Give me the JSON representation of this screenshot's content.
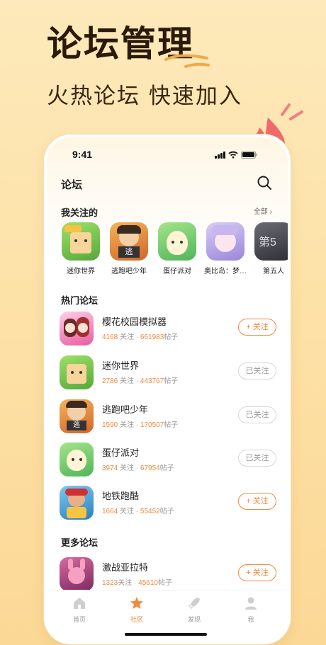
{
  "promo": {
    "title": "论坛管理",
    "subtitle": "火热论坛 快速加入"
  },
  "status_bar": {
    "time": "9:41"
  },
  "header": {
    "title": "论坛"
  },
  "followed": {
    "title": "我关注的",
    "see_all": "全部",
    "items": [
      {
        "label": "迷你世界",
        "color": "#7fc84a"
      },
      {
        "label": "逃跑吧少年",
        "color": "#f0a040"
      },
      {
        "label": "蛋仔派对",
        "color": "#7dcf7a"
      },
      {
        "label": "奥比岛：梦…",
        "color": "#b9a6e8"
      },
      {
        "label": "第五人",
        "color": "#5a5c66"
      }
    ]
  },
  "hot": {
    "title": "热门论坛",
    "stat_follow": "关注",
    "stat_posts": "帖子",
    "items": [
      {
        "name": "樱花校园模拟器",
        "follows": "4168",
        "posts": "661983",
        "button": "+ 关注",
        "followed": false
      },
      {
        "name": "迷你世界",
        "follows": "2786",
        "posts": "443767",
        "button": "已关注",
        "followed": true
      },
      {
        "name": "逃跑吧少年",
        "follows": "1590",
        "posts": "170507",
        "button": "已关注",
        "followed": true
      },
      {
        "name": "蛋仔派对",
        "follows": "3974",
        "posts": "67954",
        "button": "已关注",
        "followed": true
      },
      {
        "name": "地铁跑酷",
        "follows": "1664",
        "posts": "55452",
        "button": "+ 关注",
        "followed": false
      }
    ]
  },
  "more": {
    "title": "更多论坛",
    "items": [
      {
        "name": "激战亚拉特",
        "follows": "1323",
        "posts": "45610",
        "button": "+ 关注",
        "followed": false
      }
    ]
  },
  "tabbar": {
    "items": [
      {
        "label": "首页",
        "icon": "home-icon"
      },
      {
        "label": "社区",
        "icon": "community-icon",
        "active": true
      },
      {
        "label": "发现",
        "icon": "rocket-icon"
      },
      {
        "label": "我",
        "icon": "profile-icon"
      }
    ]
  },
  "colors": {
    "accent": "#f08a3c",
    "background": "#fde2a8"
  }
}
